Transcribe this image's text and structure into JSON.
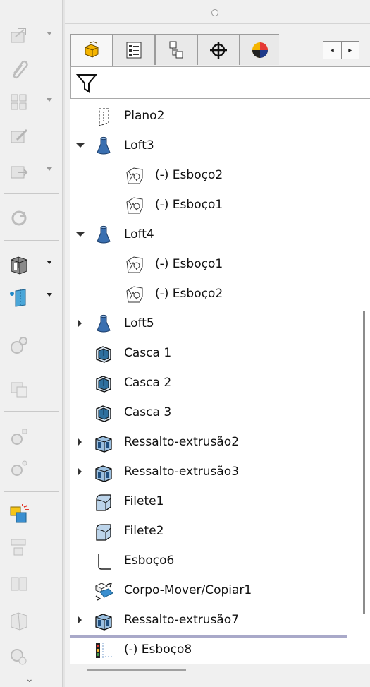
{
  "toolbar": {
    "buttons": [
      {
        "icon": "insert-part-icon",
        "dropdown": true,
        "enabled": false
      },
      {
        "icon": "paperclip-icon",
        "dropdown": false,
        "enabled": false
      },
      {
        "icon": "pattern-icon",
        "dropdown": true,
        "enabled": false
      },
      {
        "icon": "edit-component-icon",
        "dropdown": false,
        "enabled": false
      },
      {
        "icon": "move-component-icon",
        "dropdown": true,
        "enabled": false
      },
      {
        "icon": "rebuild-icon",
        "dropdown": false,
        "enabled": false
      },
      {
        "icon": "extrude-boss-icon",
        "dropdown": true,
        "enabled": true
      },
      {
        "icon": "reference-plane-icon",
        "dropdown": true,
        "enabled": true
      },
      {
        "icon": "configurations-icon",
        "dropdown": false,
        "enabled": false
      },
      {
        "icon": "display-states-icon",
        "dropdown": false,
        "enabled": false
      },
      {
        "icon": "mate-icon",
        "dropdown": false,
        "enabled": false
      },
      {
        "icon": "smart-mate-icon",
        "dropdown": false,
        "enabled": false
      },
      {
        "icon": "interference-detection-icon",
        "dropdown": false,
        "enabled": true
      },
      {
        "icon": "align-icon",
        "dropdown": false,
        "enabled": false
      },
      {
        "icon": "explode-view-icon",
        "dropdown": false,
        "enabled": false
      },
      {
        "icon": "section-view-icon",
        "dropdown": false,
        "enabled": false
      },
      {
        "icon": "motion-icon",
        "dropdown": false,
        "enabled": false
      }
    ],
    "collapse_glyph": "⌄"
  },
  "panel": {
    "tabs": [
      {
        "icon": "feature-manager-icon",
        "active": true
      },
      {
        "icon": "property-manager-icon",
        "active": false
      },
      {
        "icon": "configuration-manager-icon",
        "active": false
      },
      {
        "icon": "dimxpert-icon",
        "active": false
      },
      {
        "icon": "display-manager-icon",
        "active": false
      }
    ],
    "tab_scroll_left": "◂",
    "tab_scroll_right": "▸",
    "filter_icon": "filter-icon"
  },
  "tree": {
    "items": [
      {
        "label": "Plano2",
        "icon": "plane-icon",
        "level": 0,
        "expander": "none"
      },
      {
        "label": "Loft3",
        "icon": "loft-icon",
        "level": 0,
        "expander": "expanded"
      },
      {
        "label": "(-) Esboço2",
        "icon": "sketch-icon",
        "level": 1,
        "expander": "none"
      },
      {
        "label": "(-) Esboço1",
        "icon": "sketch-icon",
        "level": 1,
        "expander": "none"
      },
      {
        "label": "Loft4",
        "icon": "loft-icon",
        "level": 0,
        "expander": "expanded"
      },
      {
        "label": "(-) Esboço1",
        "icon": "sketch-icon",
        "level": 1,
        "expander": "none"
      },
      {
        "label": "(-) Esboço2",
        "icon": "sketch-icon",
        "level": 1,
        "expander": "none"
      },
      {
        "label": "Loft5",
        "icon": "loft-icon",
        "level": 0,
        "expander": "collapsed"
      },
      {
        "label": "Casca 1",
        "icon": "shell-icon",
        "level": 0,
        "expander": "none"
      },
      {
        "label": "Casca 2",
        "icon": "shell-icon",
        "level": 0,
        "expander": "none"
      },
      {
        "label": "Casca 3",
        "icon": "shell-icon",
        "level": 0,
        "expander": "none"
      },
      {
        "label": "Ressalto-extrusão2",
        "icon": "boss-extrude-icon",
        "level": 0,
        "expander": "collapsed"
      },
      {
        "label": "Ressalto-extrusão3",
        "icon": "boss-extrude-icon",
        "level": 0,
        "expander": "collapsed"
      },
      {
        "label": "Filete1",
        "icon": "fillet-icon",
        "level": 0,
        "expander": "none"
      },
      {
        "label": "Filete2",
        "icon": "fillet-icon",
        "level": 0,
        "expander": "none"
      },
      {
        "label": "Esboço6",
        "icon": "sketch-corner-icon",
        "level": 0,
        "expander": "none"
      },
      {
        "label": "Corpo-Mover/Copiar1",
        "icon": "move-copy-body-icon",
        "level": 0,
        "expander": "none"
      },
      {
        "label": "Ressalto-extrusão7",
        "icon": "boss-extrude-icon",
        "level": 0,
        "expander": "collapsed"
      },
      {
        "label": "(-) Esboço8",
        "icon": "rolled-back-sketch-icon",
        "level": 0,
        "expander": "none"
      }
    ]
  },
  "colors": {
    "loft_blue": "#3a6fb0",
    "shell_teal": "#2e6f9e",
    "rollback_bar": "#a9a9c9"
  }
}
